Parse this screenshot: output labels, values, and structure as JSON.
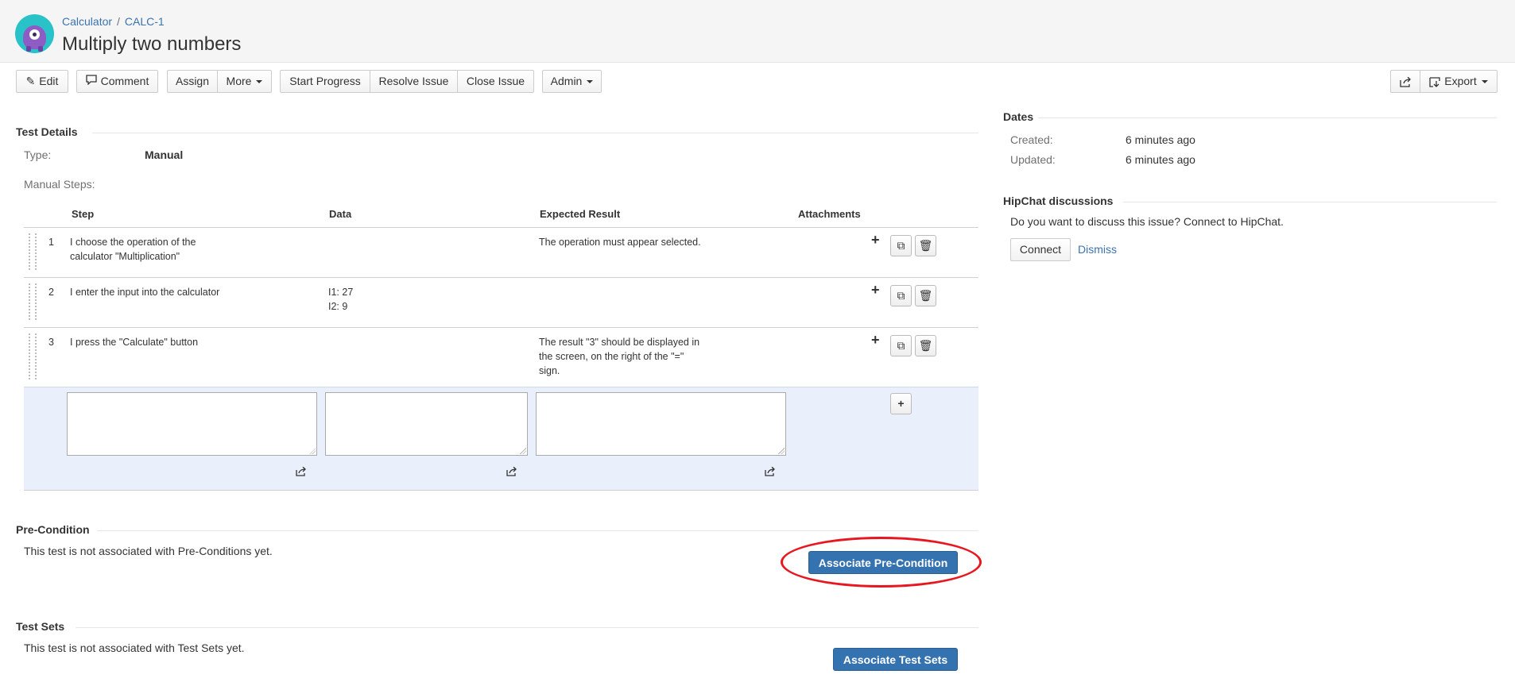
{
  "breadcrumb": {
    "project": "Calculator",
    "separator": "/",
    "issue_key": "CALC-1"
  },
  "issue": {
    "title": "Multiply two numbers"
  },
  "toolbar": {
    "edit": "Edit",
    "comment": "Comment",
    "assign": "Assign",
    "more": "More",
    "start_progress": "Start Progress",
    "resolve_issue": "Resolve Issue",
    "close_issue": "Close Issue",
    "admin": "Admin",
    "export": "Export"
  },
  "test_details": {
    "heading": "Test Details",
    "type_label": "Type:",
    "type_value": "Manual",
    "steps_label": "Manual Steps:",
    "columns": {
      "step": "Step",
      "data": "Data",
      "expected": "Expected Result",
      "attachments": "Attachments"
    },
    "steps": [
      {
        "num": "1",
        "step_lines": [
          "I choose the operation of the",
          "calculator \"Multiplication\""
        ],
        "data_lines": [],
        "expected_lines": [
          "The operation must appear selected."
        ]
      },
      {
        "num": "2",
        "step_lines": [
          "I enter the input into the calculator"
        ],
        "data_lines": [
          "I1: 27",
          "I2: 9"
        ],
        "expected_lines": []
      },
      {
        "num": "3",
        "step_lines": [
          "I press the \"Calculate\" button"
        ],
        "data_lines": [],
        "expected_lines": [
          "The result \"3\" should be displayed in",
          "the screen, on the right of the \"=\"",
          "sign."
        ]
      }
    ]
  },
  "precondition": {
    "heading": "Pre-Condition",
    "empty_text": "This test is not associated with Pre-Conditions yet.",
    "button": "Associate Pre-Condition"
  },
  "test_sets": {
    "heading": "Test Sets",
    "empty_text": "This test is not associated with Test Sets yet.",
    "button": "Associate Test Sets"
  },
  "dates": {
    "heading": "Dates",
    "created_label": "Created:",
    "created_value": "6 minutes ago",
    "updated_label": "Updated:",
    "updated_value": "6 minutes ago"
  },
  "hipchat": {
    "heading": "HipChat discussions",
    "prompt": "Do you want to discuss this issue? Connect to HipChat.",
    "connect": "Connect",
    "dismiss": "Dismiss"
  },
  "colors": {
    "link": "#3b73af",
    "primary": "#3572b0",
    "annotation": "#e8171f",
    "new_row_bg": "#eaf0fb"
  },
  "icons": [
    "project-avatar-icon",
    "pencil-icon",
    "speech-bubble-icon",
    "caret-down-icon",
    "share-icon",
    "export-icon",
    "drag-handle-icon",
    "plus-icon",
    "clone-icon",
    "trash-icon",
    "resize-grip-icon"
  ]
}
